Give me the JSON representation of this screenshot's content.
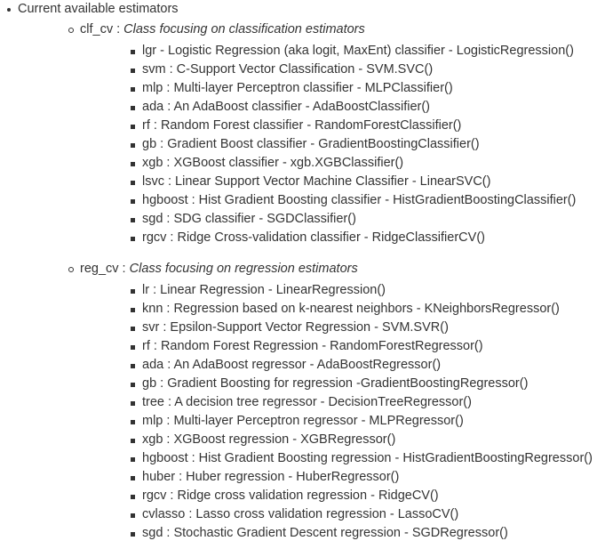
{
  "title": "Current available estimators",
  "groups": [
    {
      "name": "clf_cv",
      "sep": " : ",
      "desc": "Class focusing on classification estimators",
      "items": [
        "lgr - Logistic Regression (aka logit, MaxEnt) classifier - LogisticRegression()",
        "svm : C-Support Vector Classification - SVM.SVC()",
        "mlp : Multi-layer Perceptron classifier - MLPClassifier()",
        "ada : An AdaBoost classifier - AdaBoostClassifier()",
        "rf : Random Forest classifier - RandomForestClassifier()",
        "gb : Gradient Boost classifier - GradientBoostingClassifier()",
        "xgb : XGBoost classifier - xgb.XGBClassifier()",
        "lsvc : Linear Support Vector Machine Classifier - LinearSVC()",
        "hgboost : Hist Gradient Boosting classifier - HistGradientBoostingClassifier()",
        "sgd : SDG classifier - SGDClassifier()",
        "rgcv : Ridge Cross-validation classifier - RidgeClassifierCV()"
      ]
    },
    {
      "name": "reg_cv",
      "sep": " : ",
      "desc": "Class focusing on regression estimators",
      "items": [
        "lr : Linear Regression - LinearRegression()",
        "knn : Regression based on k-nearest neighbors - KNeighborsRegressor()",
        "svr : Epsilon-Support Vector Regression - SVM.SVR()",
        "rf : Random Forest Regression - RandomForestRegressor()",
        "ada : An AdaBoost regressor - AdaBoostRegressor()",
        "gb : Gradient Boosting for regression -GradientBoostingRegressor()",
        "tree : A decision tree regressor - DecisionTreeRegressor()",
        "mlp : Multi-layer Perceptron regressor - MLPRegressor()",
        "xgb : XGBoost regression - XGBRegressor()",
        "hgboost : Hist Gradient Boosting regression - HistGradientBoostingRegressor()",
        "huber : Huber regression - HuberRegressor()",
        "rgcv : Ridge cross validation regression - RidgeCV()",
        "cvlasso : Lasso cross validation regression - LassoCV()",
        "sgd : Stochastic Gradient Descent regression - SGDRegressor()"
      ]
    }
  ]
}
